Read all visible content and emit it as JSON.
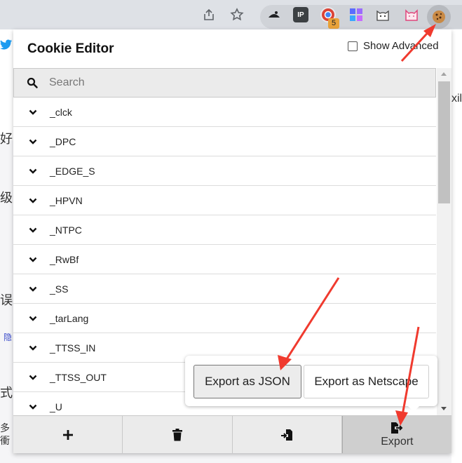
{
  "browser": {
    "extension_badge_count": "5",
    "ip_ext_label": "IP"
  },
  "background": {
    "side_chars": [
      "好",
      "级",
      "误",
      "式",
      "多"
    ],
    "side_char_2": "衝",
    "right_text": "xil",
    "link_char": "隐"
  },
  "popup": {
    "title": "Cookie Editor",
    "show_advanced_label": "Show Advanced",
    "show_advanced_checked": false,
    "search_placeholder": "Search",
    "cookies": [
      "_clck",
      "_DPC",
      "_EDGE_S",
      "_HPVN",
      "_NTPC",
      "_RwBf",
      "_SS",
      "_tarLang",
      "_TTSS_IN",
      "_TTSS_OUT",
      "_U"
    ],
    "bottom_bar": {
      "add_icon": "plus-icon",
      "delete_icon": "trash-icon",
      "import_icon": "import-icon",
      "export_icon": "export-icon",
      "export_label": "Export"
    },
    "export_menu": {
      "json_label": "Export as JSON",
      "netscape_label": "Export as Netscape"
    }
  },
  "colors": {
    "annotation_arrow": "#f03a2e",
    "toolbar_bg": "#dee1e6"
  }
}
